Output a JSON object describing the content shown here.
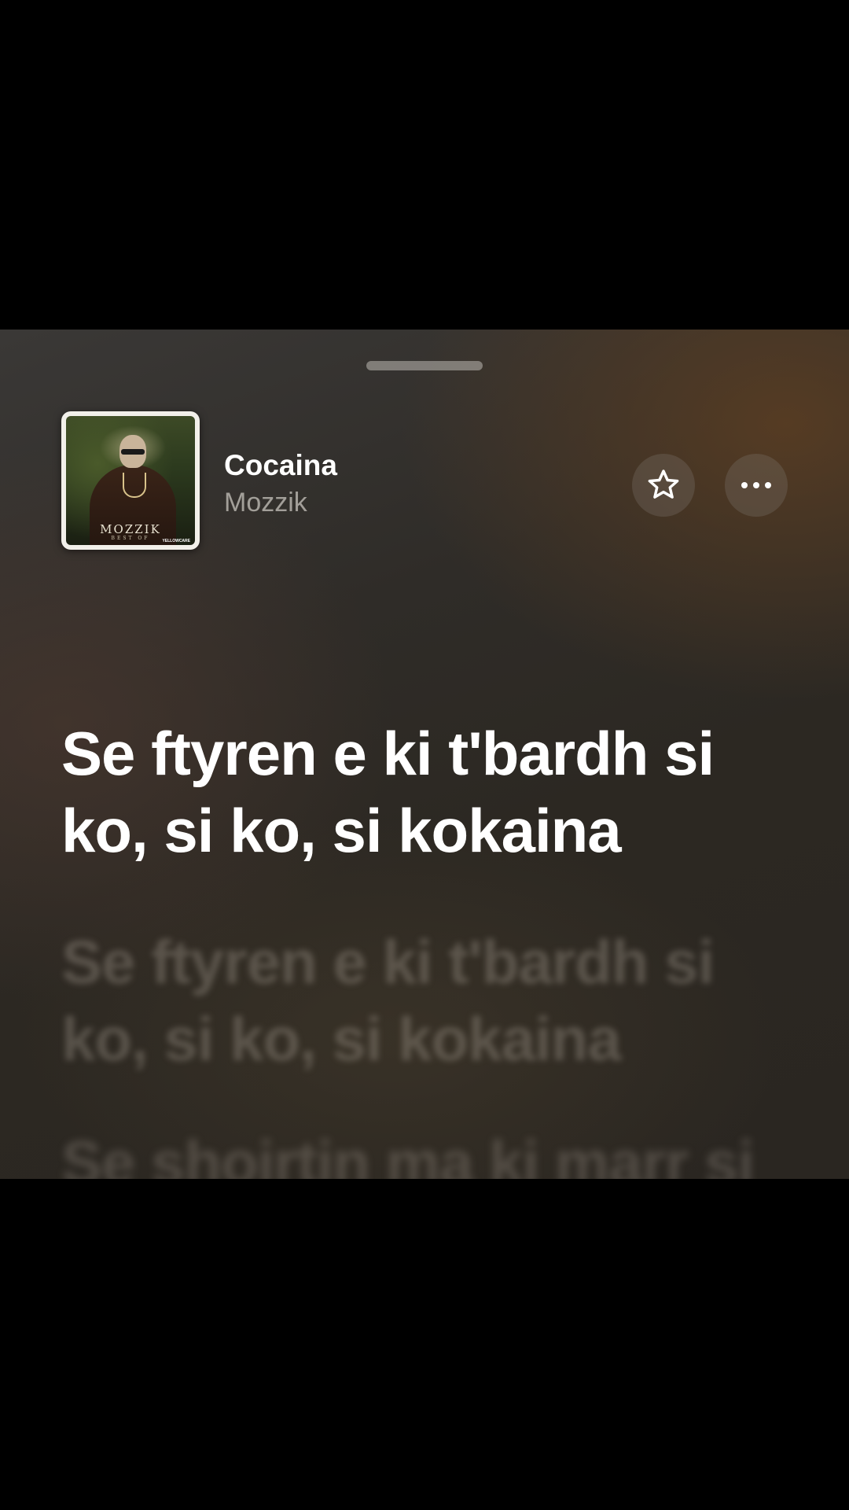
{
  "now_playing": {
    "title": "Cocaina",
    "artist": "Mozzik",
    "artwork": {
      "name_text": "MOZZIK",
      "sub_text": "BEST OF",
      "label_text": "YELLOWCARE"
    }
  },
  "actions": {
    "favorite_icon": "star-icon",
    "more_icon": "ellipsis-icon"
  },
  "lyrics": {
    "current": "Se ftyren e ki t'bardh si ko, si ko, si kokaina",
    "next": "Se ftyren e ki t'bardh si ko, si ko, si kokaina",
    "following": "Se shoirtin ma ki marr si"
  },
  "colors": {
    "background_top": "#3a3836",
    "background_warm": "#5c3e22",
    "text_primary": "#ffffff",
    "text_secondary": "#c8c4be"
  }
}
